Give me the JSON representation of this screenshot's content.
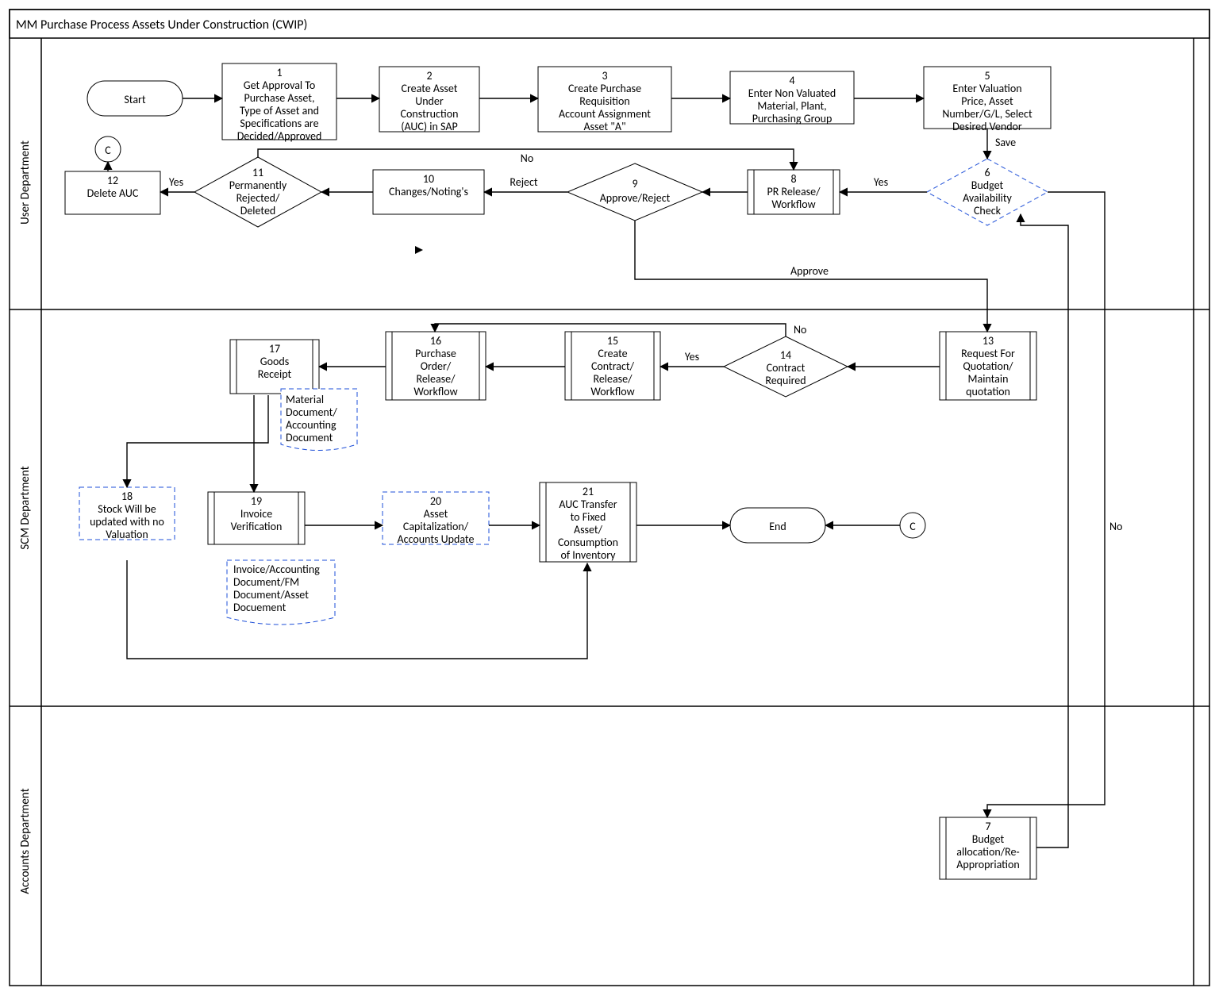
{
  "title": "MM Purchase Process Assets Under Construction (CWIP)",
  "lanes": {
    "user": "User Department",
    "scm": "SCM Department",
    "accounts": "Accounts Department"
  },
  "nodes": {
    "start": {
      "label": "Start"
    },
    "n1": {
      "num": "1",
      "lines": [
        "Get Approval To",
        "Purchase Asset,",
        "Type of Asset and",
        "Specifications are",
        "Decided/Approved"
      ]
    },
    "n2": {
      "num": "2",
      "lines": [
        "Create Asset",
        "Under",
        "Construction",
        "(AUC) in SAP"
      ]
    },
    "n3": {
      "num": "3",
      "lines": [
        "Create Purchase",
        "Requisition",
        "Account Assignment",
        "Asset \"A\""
      ]
    },
    "n4": {
      "num": "4",
      "lines": [
        "Enter Non Valuated",
        "Material, Plant,",
        "Purchasing Group"
      ]
    },
    "n5": {
      "num": "5",
      "lines": [
        "Enter Valuation",
        "Price, Asset",
        "Number/G/L, Select",
        "Desired Vendor"
      ]
    },
    "n6": {
      "num": "6",
      "lines": [
        "Budget",
        "Availability",
        "Check"
      ]
    },
    "n7": {
      "num": "7",
      "lines": [
        "Budget",
        "allocation/Re-",
        "Appropriation"
      ]
    },
    "n8": {
      "num": "8",
      "lines": [
        "PR Release/",
        "Workflow"
      ]
    },
    "n9": {
      "num": "9",
      "lines": [
        "Approve/Reject"
      ]
    },
    "n10": {
      "num": "10",
      "lines": [
        "Changes/Noting's"
      ]
    },
    "n11": {
      "num": "11",
      "lines": [
        "Permanently",
        "Rejected/",
        "Deleted"
      ]
    },
    "n12": {
      "num": "12",
      "lines": [
        "Delete AUC"
      ]
    },
    "n13": {
      "num": "13",
      "lines": [
        "Request For",
        "Quotation/",
        "Maintain",
        "quotation"
      ]
    },
    "n14": {
      "num": "14",
      "lines": [
        "Contract",
        "Required"
      ]
    },
    "n15": {
      "num": "15",
      "lines": [
        "Create",
        "Contract/",
        "Release/",
        "Workflow"
      ]
    },
    "n16": {
      "num": "16",
      "lines": [
        "Purchase",
        "Order/",
        "Release/",
        "Workflow"
      ]
    },
    "n17": {
      "num": "17",
      "lines": [
        "Goods",
        "Receipt"
      ]
    },
    "n18": {
      "num": "18",
      "lines": [
        "Stock Will be",
        "updated with no",
        "Valuation"
      ]
    },
    "n19": {
      "num": "19",
      "lines": [
        "Invoice",
        "Verification"
      ]
    },
    "n20": {
      "num": "20",
      "lines": [
        "Asset",
        "Capitalization/",
        "Accounts Update"
      ]
    },
    "n21": {
      "num": "21",
      "lines": [
        "AUC Transfer",
        "to Fixed",
        "Asset/",
        "Consumption",
        "of Inventory"
      ]
    },
    "end": {
      "label": "End"
    },
    "conC1": {
      "label": "C"
    },
    "conC2": {
      "label": "C"
    }
  },
  "notes": {
    "mat": [
      "Material",
      "Document/",
      "Accounting",
      "Document"
    ],
    "inv": [
      "Invoice/Accounting",
      "Document/FM",
      "Document/Asset",
      "Docuement"
    ]
  },
  "edgeLabels": {
    "save": "Save",
    "yes6": "Yes",
    "no6": "No",
    "reject": "Reject",
    "approve": "Approve",
    "yes11": "Yes",
    "no10": "No",
    "yes14": "Yes",
    "no14": "No"
  }
}
